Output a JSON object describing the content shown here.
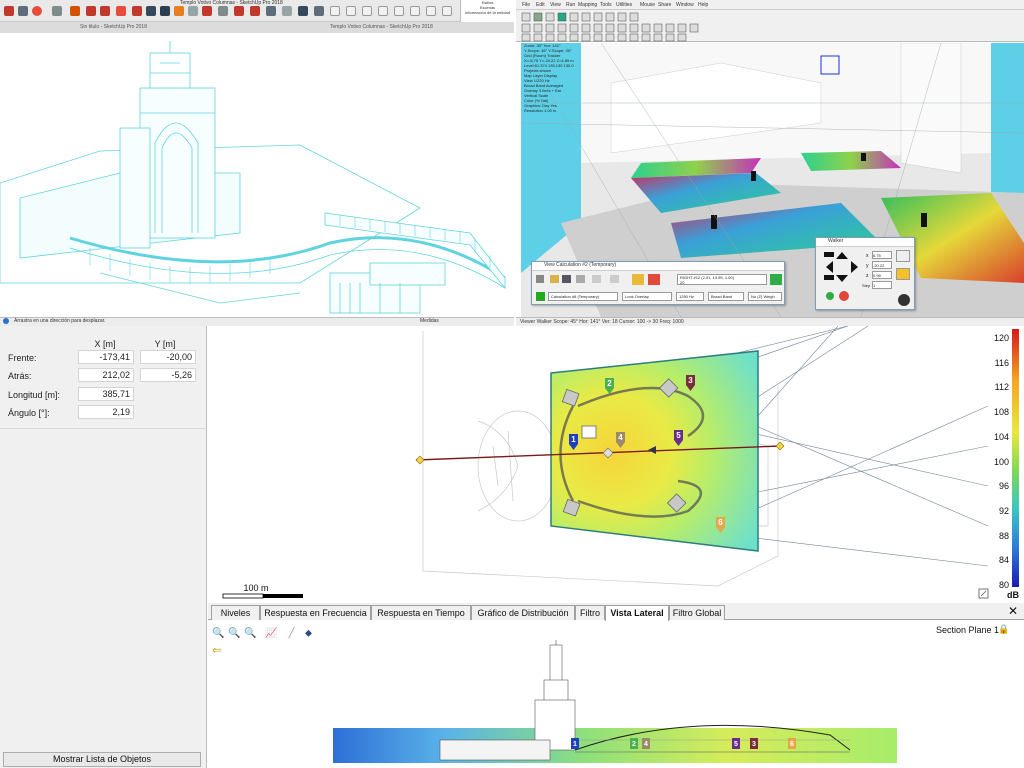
{
  "sketchup": {
    "window_title": "Templo Votivo Columnas - SketchUp Pro 2018",
    "tab_left": "Sin titulo - SketchUp Pro 2018",
    "tab_right": "Templo Votivo Columnas - SketchUp Pro 2018",
    "status_text": "Arrastra en una dirección para desplazar.",
    "measurements_label": "Medidas",
    "tray_items": [
      "Estilos",
      "Escenas",
      "Información de la entidad"
    ]
  },
  "ease": {
    "menu": [
      "File",
      "Edit",
      "View",
      "Run",
      "Mapping",
      "Tools",
      "Utilities",
      "Mouse",
      "Share",
      "Window",
      "Help"
    ],
    "status_text": "Viewer  Walker  Scope: 45°  Hor: 141°  Ver: 18  Cursor: 100 -> 30  Freq: 1000",
    "overlay_info": [
      "Zoom: 30°  Hor: 141°",
      "Y-Scope: 45°  Y-Scope: 30°",
      "Grid (Room) Tracker",
      "X=-6.75 Y=-20.22 Z=4.89 m",
      "Level 61.374 135.130 130.0",
      "Projects shown",
      "Map Layer Display",
      "View 1/220 Hz",
      "Broad Band Averaged",
      "Overlay 3 lines + Ear",
      "Vertical Scale",
      "Color (% Tab)",
      "Graphics: Day  Yes",
      "Resolution 1.00 m"
    ],
    "view_calc": {
      "title": "View Calculation #2 (Temporary)",
      "calc_select": "Calculation #8 (Temporary)",
      "map_select": "Look Overlap",
      "freq_select": "1250 Hz",
      "band_select": "Broad Band",
      "weight_select": "No (Z) Weigh",
      "info_line1": "RIGHT  #12 (2.01, 13.95, 1.00)",
      "info_line2": "20"
    },
    "walker": {
      "title": "Walker",
      "x_value": "6.75",
      "y_value": "-20.22",
      "z_value": "0.99",
      "step_label": "Step",
      "step_value": "1",
      "x_label": "x",
      "y_label": "y",
      "z_label": "z"
    }
  },
  "coords": {
    "headers": [
      "X [m]",
      "Y [m]"
    ],
    "rows": [
      {
        "label": "Frente:",
        "x": "-173,41",
        "y": "-20,00"
      },
      {
        "label": "Atrás:",
        "x": "212,02",
        "y": "-5,26"
      },
      {
        "label": "Longitud [m]:",
        "x": "385,71",
        "y": ""
      },
      {
        "label": "Ángulo [°]:",
        "x": "2,19",
        "y": ""
      }
    ]
  },
  "plan": {
    "scale_label": "100 m",
    "source_labels": [
      "1",
      "2",
      "3",
      "4",
      "5",
      "6"
    ],
    "colors": {
      "heatmap_border": "#2e7d7d",
      "section_line": "#7a1a1a",
      "source_purple": "#6a2c91",
      "source_blue": "#1f3fbf",
      "source_green": "#4caf50"
    }
  },
  "colorbar": {
    "ticks": [
      "120",
      "116",
      "112",
      "108",
      "104",
      "100",
      "96",
      "92",
      "88",
      "84",
      "80"
    ],
    "unit": "dB"
  },
  "tabs": [
    "Niveles",
    "Respuesta en Frecuencia",
    "Respuesta en Tiempo",
    "Gráfico de Distribución",
    "Filtro",
    "Vista Lateral",
    "Filtro Global"
  ],
  "active_tab": "Vista Lateral",
  "side_view": {
    "section_label": "Section Plane 1"
  },
  "buttons": {
    "object_list": "Mostrar Lista de Objetos"
  }
}
